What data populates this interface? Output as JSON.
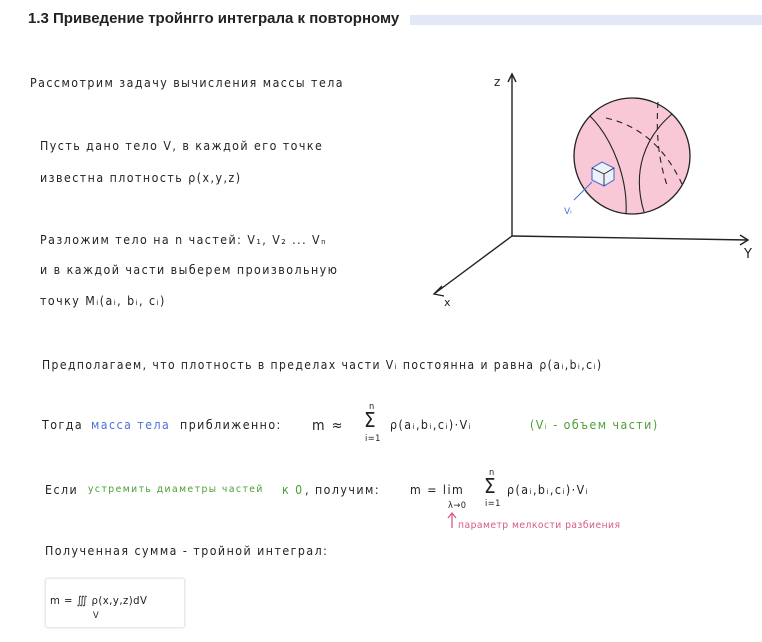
{
  "header": {
    "title": "1.3 Приведение тройнгго интеграла к повторному"
  },
  "notes": {
    "line1": "Рассмотрим задачу вычисления  массы тела",
    "line2": "Пусть дано тело V, в каждой его точке",
    "line3": "известна плотность  ρ(x,y,z)",
    "line4": "Разложим тело на  n  частей:  V₁, V₂ ... Vₙ",
    "line5": "и в каждой части выберем произвольную",
    "line6": "точку  Mᵢ(aᵢ, bᵢ, cᵢ)",
    "line7": "Предполагаем, что плотность в пределах части Vᵢ постоянна  и  равна  ρ(aᵢ,bᵢ,cᵢ)",
    "line8_prefix": "Тогда",
    "line8_mass": "масса тела",
    "line8_approx": "приближенно:",
    "formula1_m": "m ≈",
    "sum_top": "n",
    "sum_bottom": "i=1",
    "formula1_rest": "ρ(aᵢ,bᵢ,cᵢ)·Vᵢ",
    "volume_note": "(Vᵢ - объем части)",
    "line9_prefix": "Если",
    "line9_green": "устремить диаметры частей",
    "line9_limit": "к 0",
    "line9_suffix": ", получим:",
    "formula2_m": "m = lim",
    "formula2_sub": "λ→0",
    "formula2_rest": "ρ(aᵢ,bᵢ,cᵢ)·Vᵢ",
    "param_note": "параметр мелкости разбиения",
    "line10": "Полученная сумма - тройной интеграл:",
    "integral_formula": "m = ∭ ρ(x,y,z)dV",
    "integral_sub": "V"
  },
  "diagram": {
    "axis_x": "x",
    "axis_y": "Y",
    "axis_z": "z",
    "element_label": "Vᵢ"
  },
  "colors": {
    "sphere_fill": "#f8c8d6",
    "accent_blue": "#4e6fd6",
    "accent_green": "#4a9e32",
    "accent_pink": "#d8598a"
  }
}
